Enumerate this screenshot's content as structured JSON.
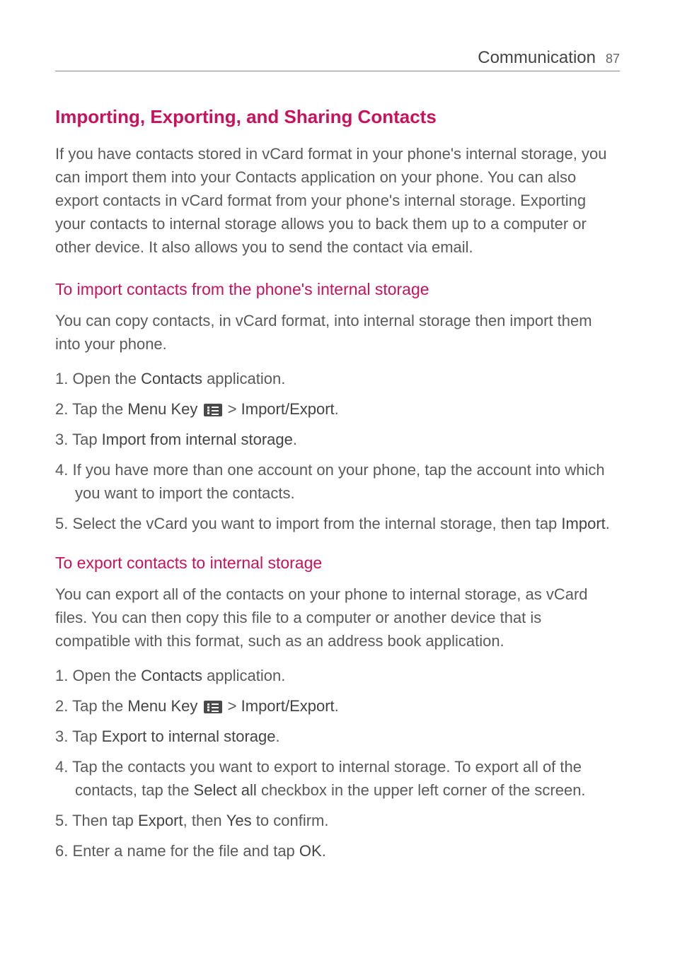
{
  "header": {
    "title": "Communication",
    "page": "87"
  },
  "main": {
    "title": "Importing, Exporting, and Sharing Contacts",
    "intro": "If you have contacts stored in vCard format in your phone's internal storage, you can import them into your Contacts application on your phone. You can also export contacts in vCard format from your phone's internal storage. Exporting your contacts to internal storage allows you to back them up to a computer or other device. It also allows you to send the contact via email.",
    "section1": {
      "heading": "To import contacts from the phone's internal storage",
      "body": "You can copy contacts, in vCard format, into internal storage then import them into your phone.",
      "steps": {
        "s1_pre": "Open the ",
        "s1_strong": "Contacts",
        "s1_post": " application.",
        "s2_pre": "Tap the ",
        "s2_strong1": "Menu Key",
        "s2_mid": " > ",
        "s2_strong2": "Import/Export",
        "s2_post": ".",
        "s3_pre": "Tap ",
        "s3_strong": "Import from internal storage",
        "s3_post": ".",
        "s4": "If you have more than one account on your phone, tap the account into which you want to import the contacts.",
        "s5_pre": "Select the vCard you want to import from the internal storage, then tap ",
        "s5_strong": "Import",
        "s5_post": "."
      }
    },
    "section2": {
      "heading": "To export contacts to internal storage",
      "body": "You can export all of the contacts on your phone to internal storage, as vCard files. You can then copy this file to a computer or another device that is compatible with this format, such as an address book application.",
      "steps": {
        "s1_pre": "Open the ",
        "s1_strong": "Contacts",
        "s1_post": " application.",
        "s2_pre": "Tap the ",
        "s2_strong1": "Menu Key",
        "s2_mid": " > ",
        "s2_strong2": "Import/Export",
        "s2_post": ".",
        "s3_pre": "Tap ",
        "s3_strong": "Export to internal storage",
        "s3_post": ".",
        "s4_pre": "Tap the contacts you want to export to internal storage. To export all of the contacts, tap the ",
        "s4_strong": "Select all",
        "s4_post": " checkbox in the upper left corner of the screen.",
        "s5_pre": "Then tap ",
        "s5_strong1": "Export",
        "s5_mid": ", then ",
        "s5_strong2": "Yes",
        "s5_post": " to confirm.",
        "s6_pre": "Enter a name for the file and tap ",
        "s6_strong": "OK",
        "s6_post": "."
      }
    }
  }
}
